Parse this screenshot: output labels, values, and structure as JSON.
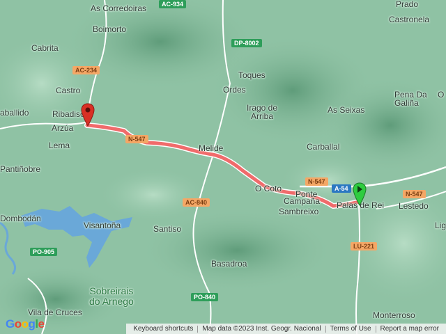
{
  "map": {
    "places": [
      {
        "id": "as-corredoiras",
        "label": "As Corredoiras"
      },
      {
        "id": "boimorto",
        "label": "Boimorto"
      },
      {
        "id": "cabrita",
        "label": "Cabrita"
      },
      {
        "id": "castro",
        "label": "Castro"
      },
      {
        "id": "ribadiso",
        "label": "Ribadiso"
      },
      {
        "id": "arzua",
        "label": "Arzúa"
      },
      {
        "id": "lema",
        "label": "Lema"
      },
      {
        "id": "pantinobre",
        "label": "Pantiñobre"
      },
      {
        "id": "caballido",
        "label": "aballido"
      },
      {
        "id": "dombodan",
        "label": "Dombodán"
      },
      {
        "id": "visantona",
        "label": "Visantoña"
      },
      {
        "id": "santiso",
        "label": "Santiso"
      },
      {
        "id": "toques",
        "label": "Toques"
      },
      {
        "id": "ordes",
        "label": "Ordes"
      },
      {
        "id": "irago",
        "label": "Irago de\nArriba"
      },
      {
        "id": "as-seixas",
        "label": "As Seixas"
      },
      {
        "id": "carballal",
        "label": "Carballal"
      },
      {
        "id": "melide",
        "label": "Melide"
      },
      {
        "id": "furelos",
        "label": "Ponte"
      },
      {
        "id": "campana",
        "label": "Campaña"
      },
      {
        "id": "sambreixo",
        "label": "Sambreixo"
      },
      {
        "id": "palas",
        "label": "Palas de Rei"
      },
      {
        "id": "o-coto",
        "label": "O Coto"
      },
      {
        "id": "basadroa",
        "label": "Basadroa"
      },
      {
        "id": "vila-cruces",
        "label": "Vila de Cruces"
      },
      {
        "id": "monterroso",
        "label": "Monterroso"
      },
      {
        "id": "lestedo",
        "label": "Lestedo"
      },
      {
        "id": "castronela",
        "label": "Castronela"
      },
      {
        "id": "prado",
        "label": "Prado"
      },
      {
        "id": "pena-galina",
        "label": "Pena Da\nGaliña"
      },
      {
        "id": "o-right",
        "label": "O"
      },
      {
        "id": "lig",
        "label": "Lig"
      },
      {
        "id": "sobreirais",
        "label": "Sobreirais\ndo Arnego"
      }
    ],
    "roads": [
      {
        "id": "ac934",
        "label": "AC-934",
        "color": "green"
      },
      {
        "id": "dp8002",
        "label": "DP-8002",
        "color": "green"
      },
      {
        "id": "ac234",
        "label": "AC-234",
        "color": "orange"
      },
      {
        "id": "n547a",
        "label": "N-547",
        "color": "orange"
      },
      {
        "id": "n547b",
        "label": "N-547",
        "color": "orange"
      },
      {
        "id": "n547c",
        "label": "N-547",
        "color": "orange"
      },
      {
        "id": "a54",
        "label": "A-54",
        "color": "blue"
      },
      {
        "id": "ac840",
        "label": "AC-840",
        "color": "orange"
      },
      {
        "id": "po905",
        "label": "PO-905",
        "color": "green"
      },
      {
        "id": "po840",
        "label": "PO-840",
        "color": "green"
      },
      {
        "id": "lu221",
        "label": "LU-221",
        "color": "orange"
      }
    ],
    "route": {
      "color": "#f06b6b",
      "start": "Palas de Rei",
      "end": "Ribadiso"
    },
    "markers": {
      "start_color": "#2ecc40",
      "end_color": "#d93025"
    }
  },
  "footer": {
    "keyboard": "Keyboard shortcuts",
    "mapdata": "Map data ©2023 Inst. Geogr. Nacional",
    "terms": "Terms of Use",
    "report": "Report a map error"
  },
  "logo": "Google",
  "colors": {
    "terrain": "#8fc2a4",
    "water": "#6aa8d8",
    "route": "#f06b6b"
  }
}
